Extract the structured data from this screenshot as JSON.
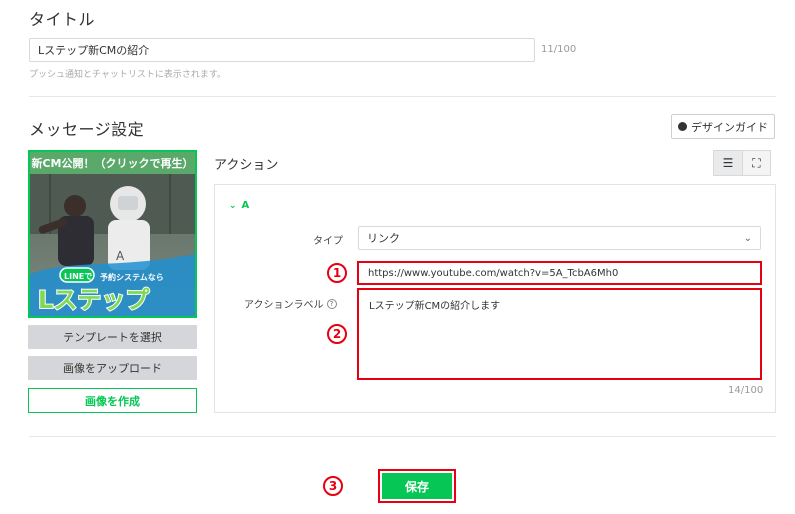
{
  "title_section": {
    "heading": "タイトル",
    "value": "Lステップ新CMの紹介",
    "counter": "11/100",
    "hint": "プッシュ通知とチャットリストに表示されます。"
  },
  "message_settings": {
    "heading": "メッセージ設定",
    "design_guide_label": "デザインガイド"
  },
  "image_card": {
    "header_text": "新CM公開！（クリックで再生）",
    "image_line_text": "LINEで",
    "image_sub_text": "予約システムなら",
    "image_brand_text": "Lステップ",
    "select_template_label": "テンプレートを選択",
    "upload_image_label": "画像をアップロード",
    "create_image_label": "画像を作成"
  },
  "action": {
    "heading": "アクション",
    "section_label": "A",
    "type_label": "タイプ",
    "type_value": "リンク",
    "url_value": "https://www.youtube.com/watch?v=5A_TcbA6Mh0",
    "action_label_label": "アクションラベル",
    "action_label_value": "Lステップ新CMの紹介します",
    "counter": "14/100"
  },
  "annotations": {
    "one": "1",
    "two": "2",
    "three": "3"
  },
  "save_label": "保存",
  "colors": {
    "accent_green": "#06c755",
    "annotation_red": "#e60012"
  }
}
